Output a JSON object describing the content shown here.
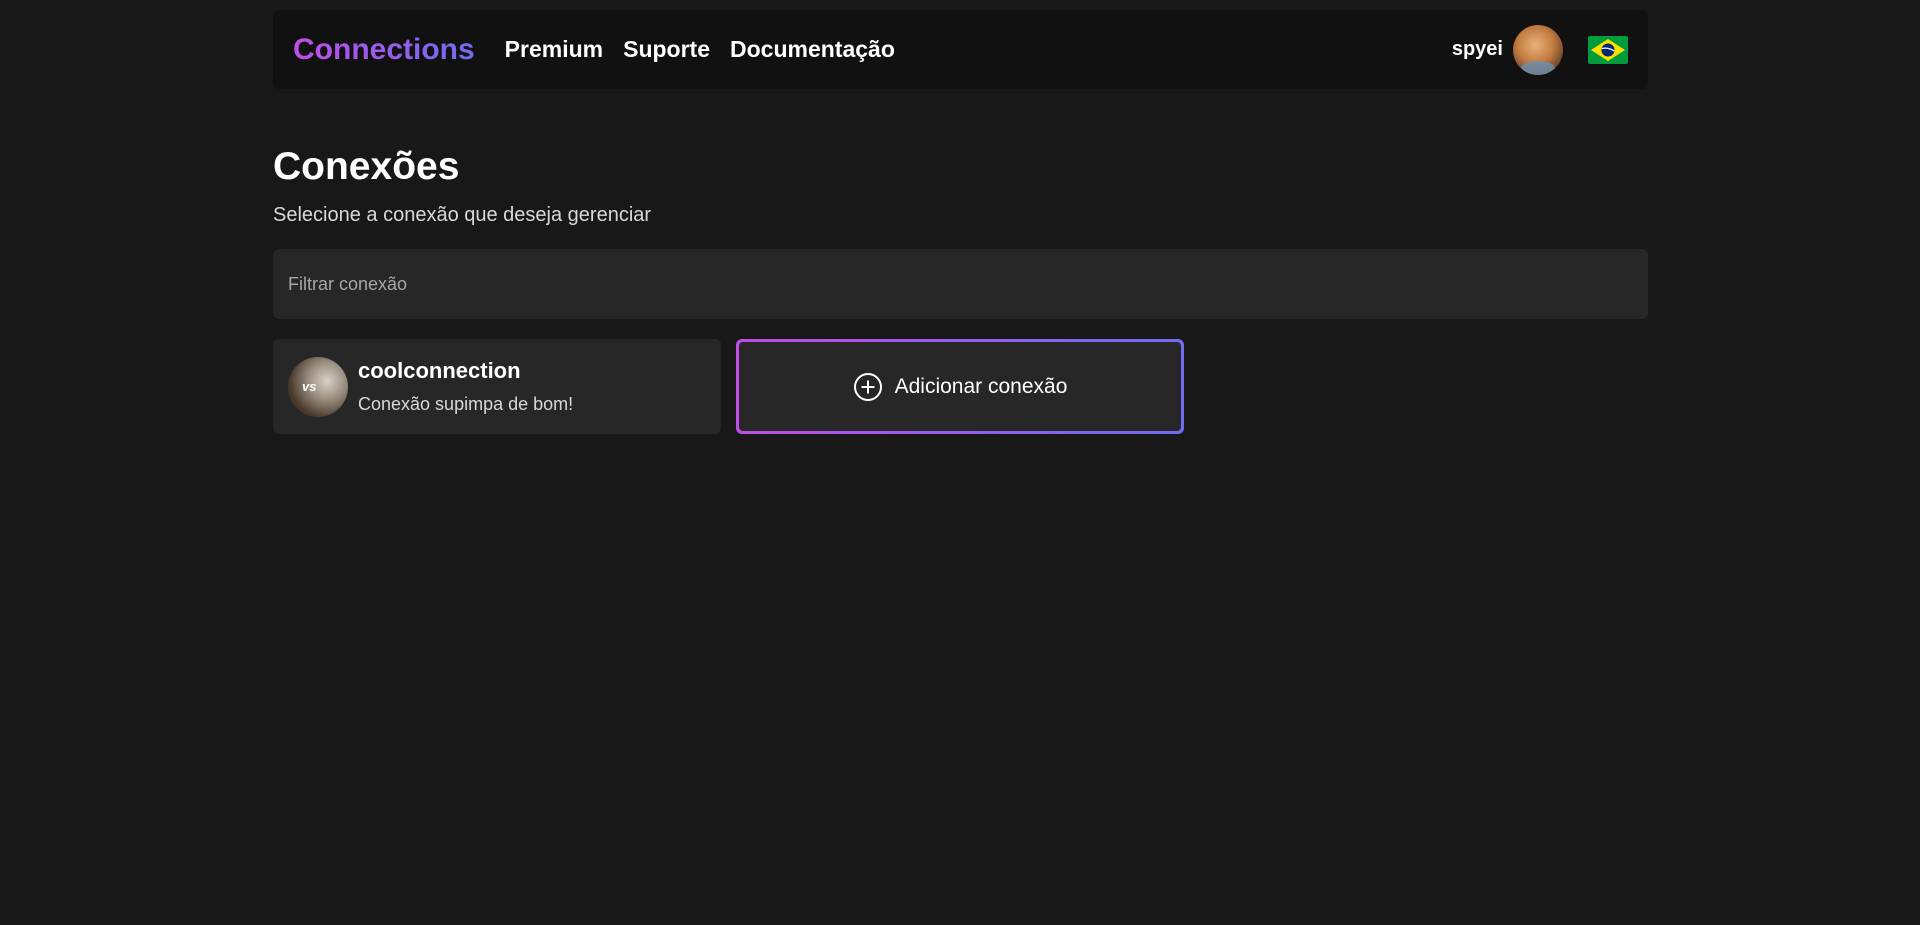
{
  "navbar": {
    "brand": "Connections",
    "links": [
      "Premium",
      "Suporte",
      "Documentação"
    ],
    "username": "spyei",
    "language_flag": "brazil-flag-icon"
  },
  "page": {
    "title": "Conexões",
    "subtitle": "Selecione a conexão que deseja gerenciar"
  },
  "filter": {
    "placeholder": "Filtrar conexão",
    "value": ""
  },
  "connections": [
    {
      "name": "coolconnection",
      "description": "Conexão supimpa de bom!",
      "avatar_icon": "cat-avatar"
    }
  ],
  "add_connection": {
    "label": "Adicionar conexão",
    "icon": "plus-circle-icon"
  },
  "colors": {
    "background": "#181818",
    "navbar": "#111111",
    "card": "#272727",
    "accent_start": "#c04ee8",
    "accent_end": "#6f6cf0"
  }
}
